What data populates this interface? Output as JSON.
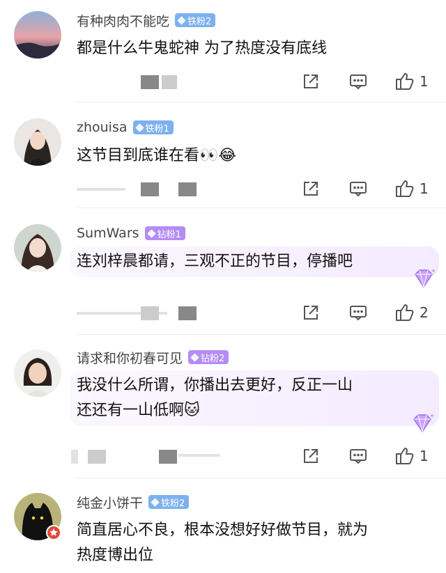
{
  "comments": [
    {
      "username": "有种肉肉不能吃",
      "badge": "铁粉2",
      "badge_type": "iron",
      "text_lines": [
        "都是什么牛鬼蛇神 为了热度没有底线"
      ],
      "likes": "1"
    },
    {
      "username": "zhouisa",
      "badge": "铁粉1",
      "badge_type": "iron",
      "text_lines": [
        "这节目到底谁在看👀😂"
      ],
      "likes": "1"
    },
    {
      "username": "SumWars",
      "badge": "钻粉1",
      "badge_type": "diamond",
      "text_lines": [
        "连刘梓晨都请，三观不正的节目，停播吧"
      ],
      "likes": "2"
    },
    {
      "username": "请求和你初春可见",
      "badge": "钻粉2",
      "badge_type": "diamond",
      "text_lines": [
        "我没什么所谓，你播出去更好，反正一山",
        "还还有一山低啊🐱"
      ],
      "likes": "1"
    },
    {
      "username": "纯金小饼干",
      "badge": "铁粉2",
      "badge_type": "iron",
      "text_lines": [
        "简直居心不良，根本没想好好做节目，就为",
        "热度博出位"
      ]
    }
  ],
  "colors": {
    "iron_badge": "#7db1ee",
    "diamond_badge": "#b48cf5",
    "text": "#111111",
    "username": "#444444"
  },
  "icons": {
    "share": "share-icon",
    "comment": "comment-icon",
    "like": "thumbs-up-icon",
    "gem": "diamond-gem-icon"
  }
}
